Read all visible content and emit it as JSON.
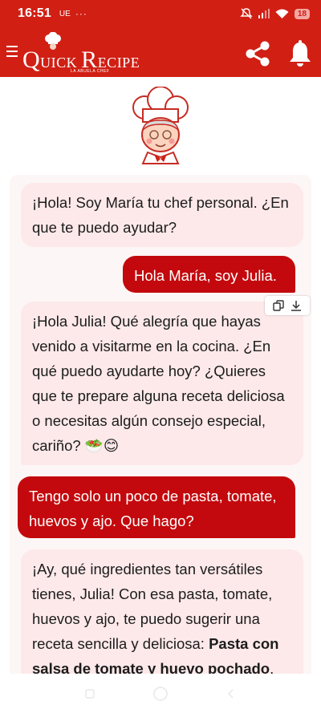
{
  "status_bar": {
    "time": "16:51",
    "carrier": "UE",
    "dots": "···",
    "battery": "18"
  },
  "app_bar": {
    "logo_text_q": "Q",
    "logo_text_uick": "UICK ",
    "logo_text_r": "R",
    "logo_text_ecipe": "ECIPE",
    "logo_subtitle": "LA ABUELA CHEF"
  },
  "chat": {
    "messages": [
      {
        "role": "bot",
        "text": "¡Hola! Soy María tu chef personal. ¿En que te puedo ayudar?"
      },
      {
        "role": "user",
        "text": "Hola María, soy Julia."
      },
      {
        "role": "bot",
        "text": "¡Hola Julia! Qué alegría que hayas venido a visitarme en la cocina. ¿En qué puedo ayudarte hoy? ¿Quieres que te prepare alguna receta deliciosa o necesitas algún consejo especial, cariño? 🥗😊"
      },
      {
        "role": "user",
        "text": "Tengo solo un poco de pasta, tomate, huevos y ajo. Que hago?"
      },
      {
        "role": "bot",
        "text": "¡Ay, qué ingredientes tan versátiles tienes, Julia! Con esa pasta, tomate, huevos y ajo, te puedo sugerir una receta sencilla y deliciosa:",
        "bold": "Pasta con salsa de tomate y huevo pochado",
        "tail_text": "."
      }
    ]
  },
  "colors": {
    "primary_red": "#d11f14",
    "user_bubble": "#c3090d",
    "bot_bubble": "#fde9ea"
  },
  "icons": [
    "menu-icon",
    "share-icon",
    "bell-icon",
    "copy-icon",
    "download-icon",
    "chef-avatar",
    "nav-recents-icon",
    "nav-home-icon",
    "nav-back-icon"
  ]
}
